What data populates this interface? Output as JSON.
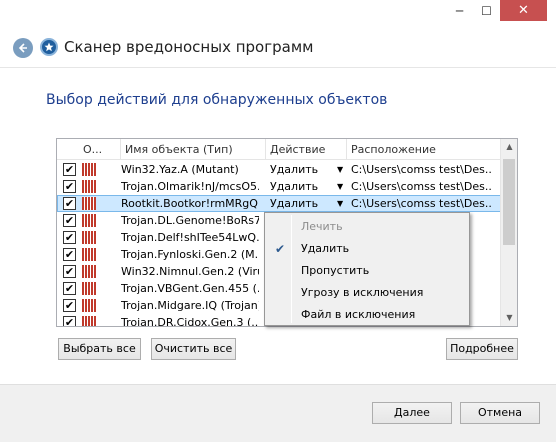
{
  "window": {
    "title": "Сканер вредоносных программ",
    "minimize_glyph": "─",
    "maximize_glyph": "☐",
    "close_glyph": "✕",
    "back_icon": "back-arrow-icon",
    "app_icon": "shield-icon"
  },
  "heading": "Выбор действий для обнаруженных объектов",
  "table": {
    "columns": [
      "О...",
      "Имя объекта (Тип)",
      "Действие",
      "Расположение"
    ],
    "rows": [
      {
        "checked": true,
        "name": "Win32.Yaz.A (Mutant)",
        "action": "Удалить",
        "path": "C:\\Users\\comss test\\Des...",
        "selected": false
      },
      {
        "checked": true,
        "name": "Trojan.Olmarik!nJ/mcsO5...",
        "action": "Удалить",
        "path": "C:\\Users\\comss test\\Des...",
        "selected": false
      },
      {
        "checked": true,
        "name": "Rootkit.Bootkor!rmMRgQ...",
        "action": "Удалить",
        "path": "C:\\Users\\comss test\\Des...",
        "selected": true
      },
      {
        "checked": true,
        "name": "Trojan.DL.Genome!BoRs7...",
        "action": "",
        "path": "",
        "selected": false
      },
      {
        "checked": true,
        "name": "Trojan.Delf!shITee54LwQ...",
        "action": "",
        "path": "",
        "selected": false
      },
      {
        "checked": true,
        "name": "Trojan.Fynloski.Gen.2 (M...",
        "action": "",
        "path": "",
        "selected": false
      },
      {
        "checked": true,
        "name": "Win32.Nimnul.Gen.2 (Virus)",
        "action": "",
        "path": "",
        "selected": false
      },
      {
        "checked": true,
        "name": "Trojan.VBGent.Gen.455 (...",
        "action": "",
        "path": "",
        "selected": false
      },
      {
        "checked": true,
        "name": "Trojan.Midgare.IQ (Trojan)",
        "action": "",
        "path": "",
        "selected": false
      },
      {
        "checked": true,
        "name": "Trojan.DR.Cidox.Gen.3 (...",
        "action": "",
        "path": "",
        "selected": false
      }
    ],
    "check_glyph": "✔",
    "dropdown_glyph": "▼",
    "scroll_up_glyph": "▲",
    "scroll_down_glyph": "▼"
  },
  "context_menu": {
    "items": [
      {
        "label": "Лечить",
        "disabled": true,
        "checked": false
      },
      {
        "label": "Удалить",
        "disabled": false,
        "checked": true
      },
      {
        "label": "Пропустить",
        "disabled": false,
        "checked": false
      },
      {
        "label": "Угрозу в исключения",
        "disabled": false,
        "checked": false
      },
      {
        "label": "Файл в исключения",
        "disabled": false,
        "checked": false
      }
    ],
    "check_glyph": "✔"
  },
  "buttons": {
    "select_all": "Выбрать все",
    "clear_all": "Очистить все",
    "details": "Подробнее",
    "next": "Далее",
    "cancel": "Отмена"
  },
  "colors": {
    "heading": "#1e3f8f",
    "selection": "#cde8ff",
    "threat": "#c0392b"
  }
}
